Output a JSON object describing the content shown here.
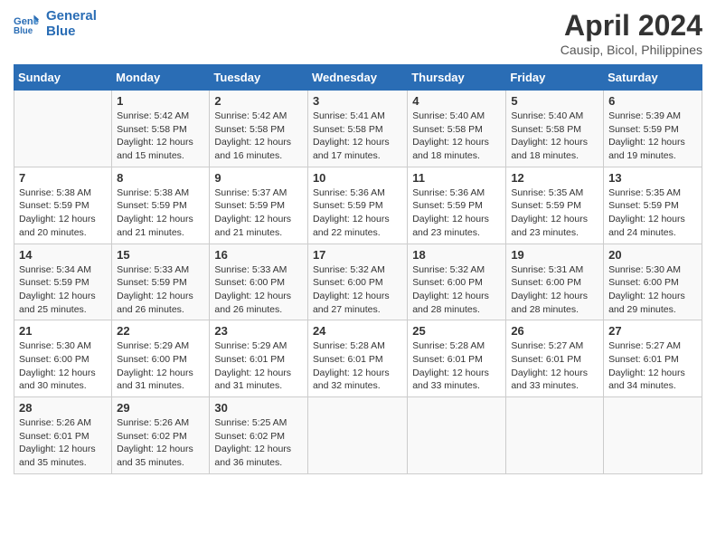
{
  "header": {
    "logo_line1": "General",
    "logo_line2": "Blue",
    "month_title": "April 2024",
    "subtitle": "Causip, Bicol, Philippines"
  },
  "days_of_week": [
    "Sunday",
    "Monday",
    "Tuesday",
    "Wednesday",
    "Thursday",
    "Friday",
    "Saturday"
  ],
  "weeks": [
    [
      {
        "day": "",
        "info": ""
      },
      {
        "day": "1",
        "info": "Sunrise: 5:42 AM\nSunset: 5:58 PM\nDaylight: 12 hours\nand 15 minutes."
      },
      {
        "day": "2",
        "info": "Sunrise: 5:42 AM\nSunset: 5:58 PM\nDaylight: 12 hours\nand 16 minutes."
      },
      {
        "day": "3",
        "info": "Sunrise: 5:41 AM\nSunset: 5:58 PM\nDaylight: 12 hours\nand 17 minutes."
      },
      {
        "day": "4",
        "info": "Sunrise: 5:40 AM\nSunset: 5:58 PM\nDaylight: 12 hours\nand 18 minutes."
      },
      {
        "day": "5",
        "info": "Sunrise: 5:40 AM\nSunset: 5:58 PM\nDaylight: 12 hours\nand 18 minutes."
      },
      {
        "day": "6",
        "info": "Sunrise: 5:39 AM\nSunset: 5:59 PM\nDaylight: 12 hours\nand 19 minutes."
      }
    ],
    [
      {
        "day": "7",
        "info": "Sunrise: 5:38 AM\nSunset: 5:59 PM\nDaylight: 12 hours\nand 20 minutes."
      },
      {
        "day": "8",
        "info": "Sunrise: 5:38 AM\nSunset: 5:59 PM\nDaylight: 12 hours\nand 21 minutes."
      },
      {
        "day": "9",
        "info": "Sunrise: 5:37 AM\nSunset: 5:59 PM\nDaylight: 12 hours\nand 21 minutes."
      },
      {
        "day": "10",
        "info": "Sunrise: 5:36 AM\nSunset: 5:59 PM\nDaylight: 12 hours\nand 22 minutes."
      },
      {
        "day": "11",
        "info": "Sunrise: 5:36 AM\nSunset: 5:59 PM\nDaylight: 12 hours\nand 23 minutes."
      },
      {
        "day": "12",
        "info": "Sunrise: 5:35 AM\nSunset: 5:59 PM\nDaylight: 12 hours\nand 23 minutes."
      },
      {
        "day": "13",
        "info": "Sunrise: 5:35 AM\nSunset: 5:59 PM\nDaylight: 12 hours\nand 24 minutes."
      }
    ],
    [
      {
        "day": "14",
        "info": "Sunrise: 5:34 AM\nSunset: 5:59 PM\nDaylight: 12 hours\nand 25 minutes."
      },
      {
        "day": "15",
        "info": "Sunrise: 5:33 AM\nSunset: 5:59 PM\nDaylight: 12 hours\nand 26 minutes."
      },
      {
        "day": "16",
        "info": "Sunrise: 5:33 AM\nSunset: 6:00 PM\nDaylight: 12 hours\nand 26 minutes."
      },
      {
        "day": "17",
        "info": "Sunrise: 5:32 AM\nSunset: 6:00 PM\nDaylight: 12 hours\nand 27 minutes."
      },
      {
        "day": "18",
        "info": "Sunrise: 5:32 AM\nSunset: 6:00 PM\nDaylight: 12 hours\nand 28 minutes."
      },
      {
        "day": "19",
        "info": "Sunrise: 5:31 AM\nSunset: 6:00 PM\nDaylight: 12 hours\nand 28 minutes."
      },
      {
        "day": "20",
        "info": "Sunrise: 5:30 AM\nSunset: 6:00 PM\nDaylight: 12 hours\nand 29 minutes."
      }
    ],
    [
      {
        "day": "21",
        "info": "Sunrise: 5:30 AM\nSunset: 6:00 PM\nDaylight: 12 hours\nand 30 minutes."
      },
      {
        "day": "22",
        "info": "Sunrise: 5:29 AM\nSunset: 6:00 PM\nDaylight: 12 hours\nand 31 minutes."
      },
      {
        "day": "23",
        "info": "Sunrise: 5:29 AM\nSunset: 6:01 PM\nDaylight: 12 hours\nand 31 minutes."
      },
      {
        "day": "24",
        "info": "Sunrise: 5:28 AM\nSunset: 6:01 PM\nDaylight: 12 hours\nand 32 minutes."
      },
      {
        "day": "25",
        "info": "Sunrise: 5:28 AM\nSunset: 6:01 PM\nDaylight: 12 hours\nand 33 minutes."
      },
      {
        "day": "26",
        "info": "Sunrise: 5:27 AM\nSunset: 6:01 PM\nDaylight: 12 hours\nand 33 minutes."
      },
      {
        "day": "27",
        "info": "Sunrise: 5:27 AM\nSunset: 6:01 PM\nDaylight: 12 hours\nand 34 minutes."
      }
    ],
    [
      {
        "day": "28",
        "info": "Sunrise: 5:26 AM\nSunset: 6:01 PM\nDaylight: 12 hours\nand 35 minutes."
      },
      {
        "day": "29",
        "info": "Sunrise: 5:26 AM\nSunset: 6:02 PM\nDaylight: 12 hours\nand 35 minutes."
      },
      {
        "day": "30",
        "info": "Sunrise: 5:25 AM\nSunset: 6:02 PM\nDaylight: 12 hours\nand 36 minutes."
      },
      {
        "day": "",
        "info": ""
      },
      {
        "day": "",
        "info": ""
      },
      {
        "day": "",
        "info": ""
      },
      {
        "day": "",
        "info": ""
      }
    ]
  ]
}
